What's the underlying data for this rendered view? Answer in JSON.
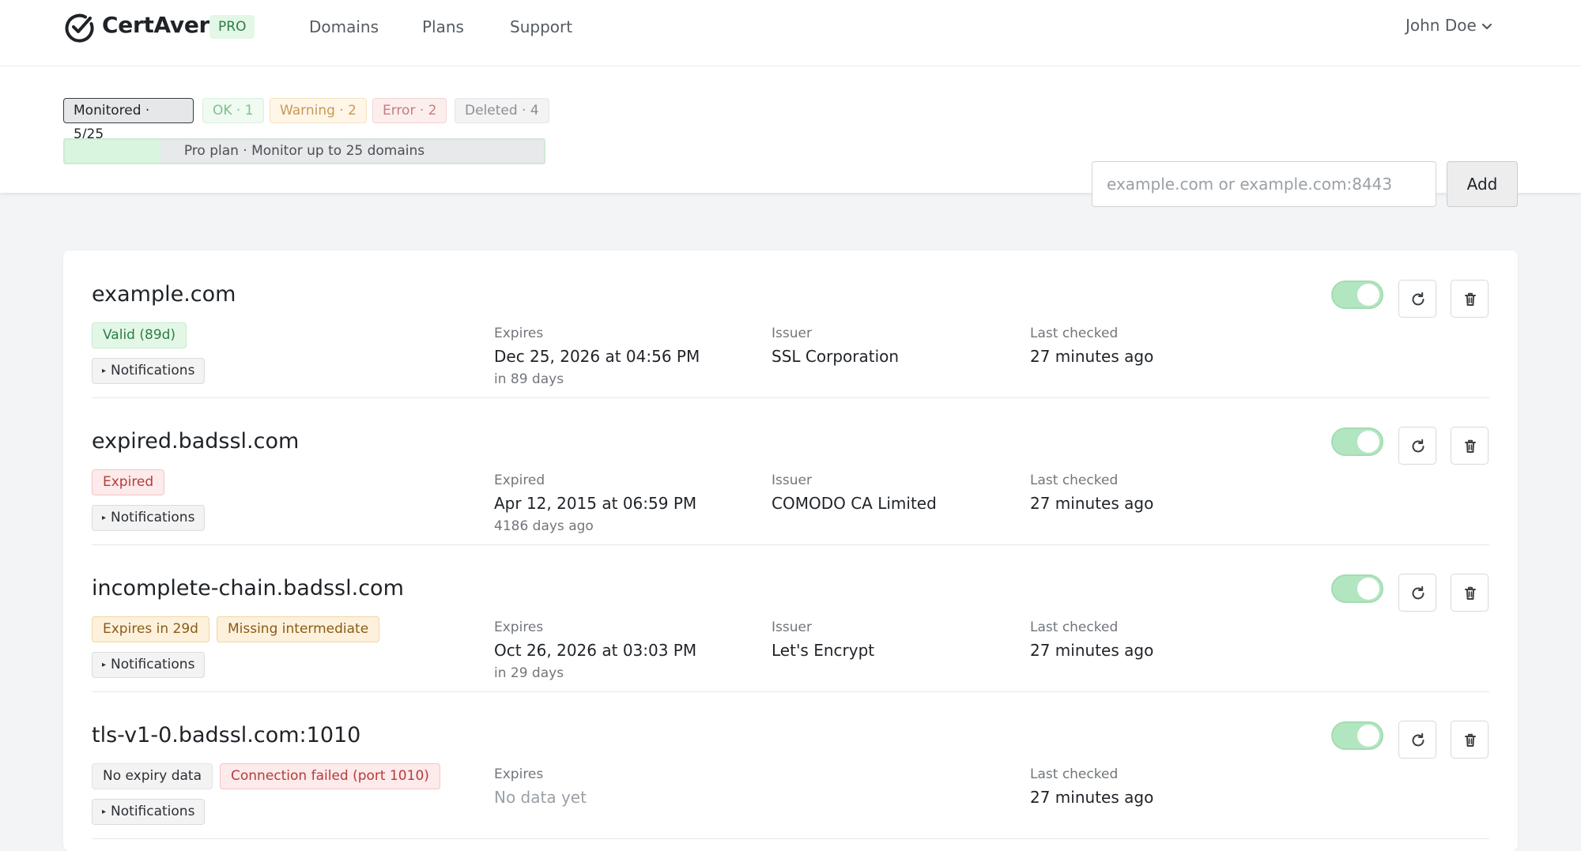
{
  "header": {
    "brand": "CertAvert",
    "badge": "PRO",
    "nav": [
      {
        "label": "Domains"
      },
      {
        "label": "Plans"
      },
      {
        "label": "Support"
      }
    ],
    "user": "John Doe"
  },
  "filters": {
    "monitored": "Monitored · 5/25",
    "ok": "OK · 1",
    "warning": "Warning · 2",
    "error": "Error · 2",
    "deleted": "Deleted · 4"
  },
  "plan": {
    "text": "Pro plan · Monitor up to 25 domains",
    "used": 5,
    "limit": 25
  },
  "add_form": {
    "placeholder": "example.com or example.com:8443",
    "value": "",
    "button": "Add"
  },
  "colors": {
    "success": "#2e7d44",
    "warning": "#8a5b17",
    "danger": "#b43c3c",
    "toggle_on": "#b2e6c0"
  },
  "domains": [
    {
      "name": "example.com",
      "tags": [
        {
          "label": "Valid (89d)",
          "kind": "success"
        }
      ],
      "notifications_label": "Notifications",
      "expiry_label": "Expires",
      "expiry_value": "Dec 25, 2026 at 04:56 PM",
      "expiry_sub": "in 89 days",
      "issuer_label": "Issuer",
      "issuer_value": "SSL Corporation",
      "checked_label": "Last checked",
      "checked_value": "27 minutes ago",
      "enabled": true
    },
    {
      "name": "expired.badssl.com",
      "tags": [
        {
          "label": "Expired",
          "kind": "danger"
        }
      ],
      "notifications_label": "Notifications",
      "expiry_label": "Expired",
      "expiry_value": "Apr 12, 2015 at 06:59 PM",
      "expiry_sub": "4186 days ago",
      "issuer_label": "Issuer",
      "issuer_value": "COMODO CA Limited",
      "checked_label": "Last checked",
      "checked_value": "27 minutes ago",
      "enabled": true
    },
    {
      "name": "incomplete-chain.badssl.com",
      "tags": [
        {
          "label": "Expires in 29d",
          "kind": "warning"
        },
        {
          "label": "Missing intermediate",
          "kind": "warning"
        }
      ],
      "notifications_label": "Notifications",
      "expiry_label": "Expires",
      "expiry_value": "Oct 26, 2026 at 03:03 PM",
      "expiry_sub": "in 29 days",
      "issuer_label": "Issuer",
      "issuer_value": "Let's Encrypt",
      "checked_label": "Last checked",
      "checked_value": "27 minutes ago",
      "enabled": true
    },
    {
      "name": "tls-v1-0.badssl.com:1010",
      "tags": [
        {
          "label": "No expiry data",
          "kind": "neutral"
        },
        {
          "label": "Connection failed (port 1010)",
          "kind": "danger"
        }
      ],
      "notifications_label": "Notifications",
      "expiry_label": "Expires",
      "expiry_value": "No data yet",
      "expiry_sub": "",
      "issuer_label": "",
      "issuer_value": "",
      "checked_label": "Last checked",
      "checked_value": "27 minutes ago",
      "enabled": true
    }
  ]
}
